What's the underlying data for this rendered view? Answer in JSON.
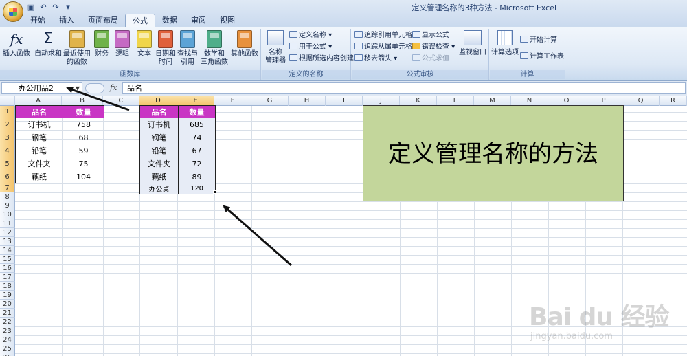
{
  "window_title": "定义管理名称的3种方法 - Microsoft Excel",
  "qat": [
    "save-icon",
    "undo-icon",
    "redo-icon",
    "customize-icon"
  ],
  "tabs": [
    "开始",
    "插入",
    "页面布局",
    "公式",
    "数据",
    "审阅",
    "视图"
  ],
  "active_tab": "公式",
  "ribbon": {
    "function_library": {
      "label": "函数库",
      "insert_function": "插入函数",
      "autosum": "自动求和",
      "recent_line1": "最近使用",
      "recent_line2": "的函数",
      "financial": "财务",
      "logical": "逻辑",
      "text": "文本",
      "datetime_line1": "日期和",
      "datetime_line2": "时间",
      "lookup_line1": "查找与",
      "lookup_line2": "引用",
      "math_line1": "数学和",
      "math_line2": "三角函数",
      "more": "其他函数"
    },
    "defined_names": {
      "label": "定义的名称",
      "name_manager_line1": "名称",
      "name_manager_line2": "管理器",
      "define_name": "定义名称",
      "use_in_formula": "用于公式",
      "create_from_selection": "根据所选内容创建"
    },
    "formula_auditing": {
      "label": "公式审核",
      "trace_precedents": "追踪引用单元格",
      "trace_dependents": "追踪从属单元格",
      "remove_arrows": "移去箭头",
      "show_formulas": "显示公式",
      "error_checking": "错误检查",
      "evaluate_formula": "公式求值",
      "watch_window": "监视窗口"
    },
    "calculation": {
      "label": "计算",
      "calc_options": "计算选项",
      "calc_now": "开始计算",
      "calc_sheet": "计算工作表"
    }
  },
  "formula_bar": {
    "name_box": "办公用品2",
    "fx": "fx",
    "content": "品名"
  },
  "columns": [
    "A",
    "B",
    "C",
    "D",
    "E",
    "F",
    "G",
    "H",
    "I",
    "J",
    "K",
    "L",
    "M",
    "N",
    "O",
    "P",
    "Q",
    "R"
  ],
  "rows": [
    "1",
    "2",
    "3",
    "4",
    "5",
    "6",
    "7",
    "8",
    "9",
    "10",
    "11",
    "12",
    "13",
    "14",
    "15",
    "16",
    "17",
    "18",
    "19",
    "20",
    "21",
    "22",
    "23",
    "24",
    "25",
    "26"
  ],
  "table1": {
    "headers": [
      "品名",
      "数量"
    ],
    "rows": [
      [
        "订书机",
        "758"
      ],
      [
        "钢笔",
        "68"
      ],
      [
        "铅笔",
        "59"
      ],
      [
        "文件夹",
        "75"
      ],
      [
        "藕纸",
        "104"
      ]
    ]
  },
  "table2": {
    "headers": [
      "品名",
      "数量"
    ],
    "rows": [
      [
        "订书机",
        "685"
      ],
      [
        "钢笔",
        "74"
      ],
      [
        "铅笔",
        "67"
      ],
      [
        "文件夹",
        "72"
      ],
      [
        "藕纸",
        "89"
      ],
      [
        "办公桌",
        "120"
      ]
    ]
  },
  "title_box": "定义管理名称的方法",
  "watermark": {
    "main": "Bai du 经验",
    "url": "jingyan.baidu.com"
  },
  "colors": {
    "header_magenta": "#c935c4",
    "title_box_green": "#c3d69b",
    "ribbon_blue": "#dde8f5"
  }
}
